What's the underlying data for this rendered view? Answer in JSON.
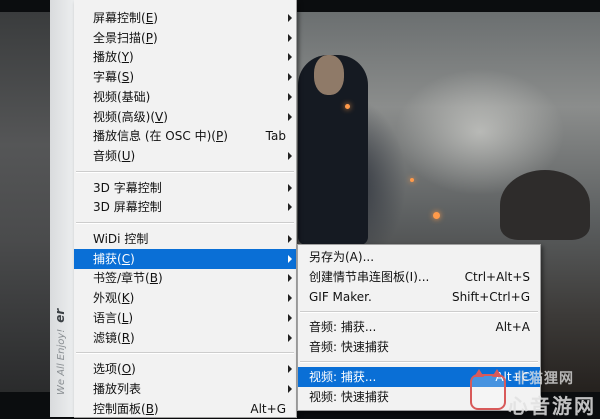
{
  "brand": {
    "tagline": "We All Enjoy!",
    "name_fragment": "er"
  },
  "main_menu": {
    "groups": [
      [
        {
          "label": "屏幕控制",
          "key": "E",
          "submenu": true
        },
        {
          "label": "全景扫描",
          "key": "P",
          "submenu": true
        },
        {
          "label": "播放",
          "key": "Y",
          "submenu": true
        },
        {
          "label": "字幕",
          "key": "S",
          "submenu": true
        },
        {
          "label": "视频(基础)",
          "submenu": true
        },
        {
          "label": "视频(高级)",
          "key": "V",
          "submenu": true
        },
        {
          "label": "播放信息 (在 OSC 中)",
          "key": "P",
          "shortcut": "Tab"
        },
        {
          "label": "音频",
          "key": "U",
          "submenu": true
        }
      ],
      [
        {
          "label": "3D 字幕控制",
          "submenu": true
        },
        {
          "label": "3D 屏幕控制",
          "submenu": true
        }
      ],
      [
        {
          "label": "WiDi 控制",
          "submenu": true
        },
        {
          "label": "捕获",
          "key": "C",
          "submenu": true,
          "highlighted": true
        },
        {
          "label": "书签/章节",
          "key": "B",
          "submenu": true
        },
        {
          "label": "外观",
          "key": "K",
          "submenu": true
        },
        {
          "label": "语言",
          "key": "L",
          "submenu": true
        },
        {
          "label": "滤镜",
          "key": "R",
          "submenu": true
        }
      ],
      [
        {
          "label": "选项",
          "key": "O",
          "submenu": true
        },
        {
          "label": "播放列表",
          "submenu": true
        },
        {
          "label": "控制面板",
          "key": "B",
          "shortcut": "Alt+G"
        }
      ]
    ]
  },
  "capture_submenu": {
    "groups": [
      [
        {
          "label": "另存为(A)..."
        },
        {
          "label": "创建情节串连图板(I)...",
          "shortcut": "Ctrl+Alt+S"
        },
        {
          "label": "GIF Maker.",
          "shortcut": "Shift+Ctrl+G"
        }
      ],
      [
        {
          "label": "音频: 捕获...",
          "shortcut": "Alt+A"
        },
        {
          "label": "音频: 快速捕获"
        }
      ],
      [
        {
          "label": "视频: 捕获...",
          "shortcut": "Alt+C",
          "highlighted": true
        },
        {
          "label": "视频: 快速捕获"
        }
      ]
    ]
  },
  "watermark": {
    "line1": "非猫狸网",
    "line2": "心音游网"
  },
  "colors": {
    "highlight": "#0a6fd6",
    "menu_bg": "#f2f2f2"
  }
}
